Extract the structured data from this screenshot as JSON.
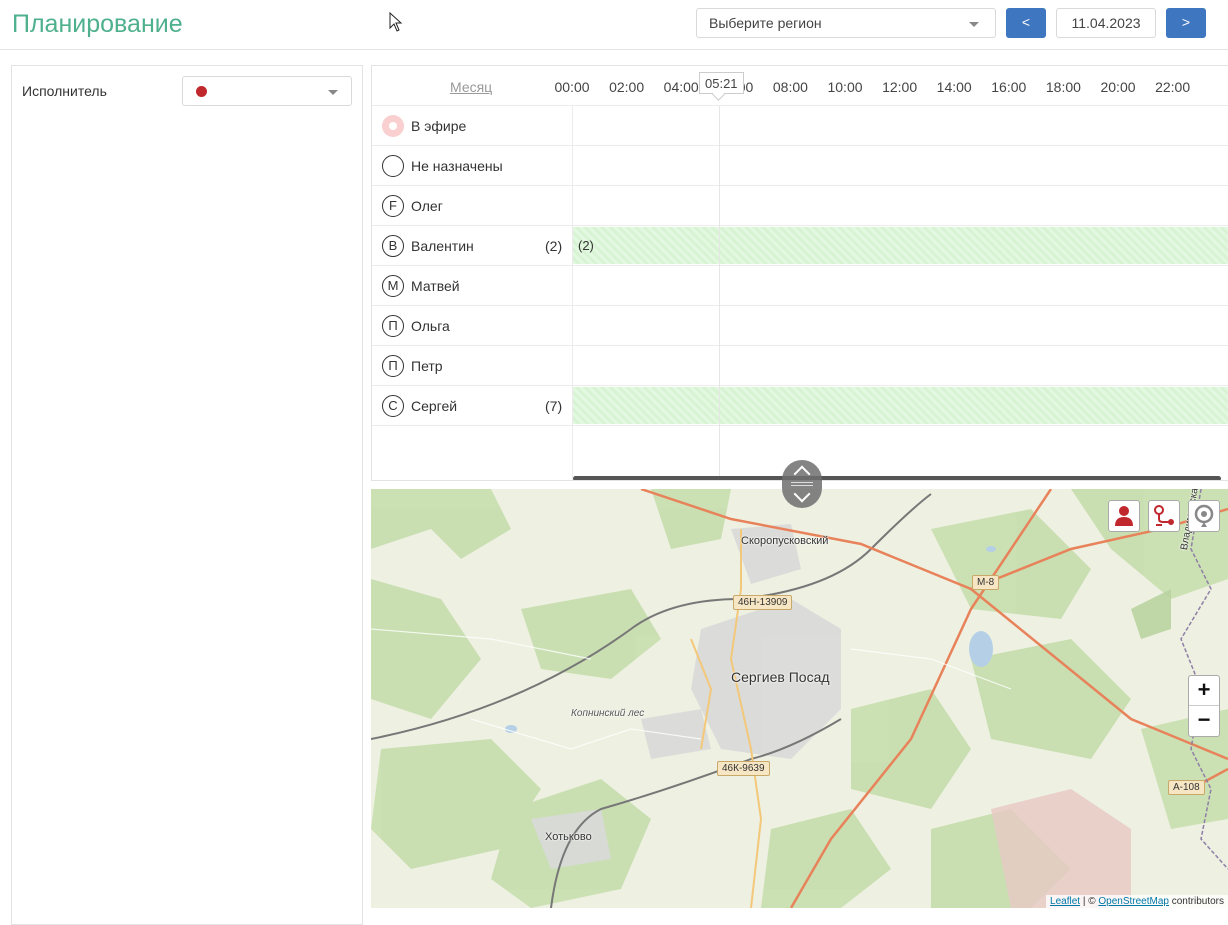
{
  "header": {
    "title": "Планирование",
    "region_placeholder": "Выберите регион",
    "prev_label": "<",
    "next_label": ">",
    "date": "11.04.2023"
  },
  "filters": {
    "executor_label": "Исполнитель",
    "executor_dot_color": "#c0282d"
  },
  "schedule": {
    "month_link": "Месяц",
    "now_time": "05:21",
    "hours": [
      "00:00",
      "02:00",
      "04:00",
      "06:00",
      "08:00",
      "10:00",
      "12:00",
      "14:00",
      "16:00",
      "18:00",
      "20:00",
      "22:00"
    ],
    "rows": [
      {
        "avatar": "",
        "kind": "live",
        "name": "В эфире",
        "count": "",
        "bar_label": "",
        "has_bar": false
      },
      {
        "avatar": "",
        "kind": "circle",
        "name": "Не назначены",
        "count": "",
        "bar_label": "",
        "has_bar": false
      },
      {
        "avatar": "F",
        "kind": "circle",
        "name": "Олег",
        "count": "",
        "bar_label": "",
        "has_bar": false
      },
      {
        "avatar": "В",
        "kind": "circle",
        "name": "Валентин",
        "count": "(2)",
        "bar_label": "(2)",
        "has_bar": true
      },
      {
        "avatar": "М",
        "kind": "circle",
        "name": "Матвей",
        "count": "",
        "bar_label": "",
        "has_bar": false
      },
      {
        "avatar": "П",
        "kind": "circle",
        "name": "Ольга",
        "count": "",
        "bar_label": "",
        "has_bar": false
      },
      {
        "avatar": "П",
        "kind": "circle",
        "name": "Петр",
        "count": "",
        "bar_label": "",
        "has_bar": false
      },
      {
        "avatar": "С",
        "kind": "circle",
        "name": "Сергей",
        "count": "(7)",
        "bar_label": "",
        "has_bar": true
      }
    ]
  },
  "map": {
    "labels": {
      "skoropuskovsky": "Скоропусковский",
      "sergiev_posad": "Сергиев Посад",
      "khotkovo": "Хотьково",
      "kopninsky_les": "Копнинский лес",
      "vladimirskaya": "Владимирская"
    },
    "roads": {
      "r1": "46Н-13909",
      "r2": "46К-9639",
      "m8": "М-8",
      "a108": "А-108"
    },
    "controls": {
      "person_icon": "person-icon",
      "route_icon": "route-icon",
      "geo_icon": "geo-target-icon",
      "zoom_in": "+",
      "zoom_out": "−"
    },
    "attribution": {
      "leaflet": "Leaflet",
      "sep": " | © ",
      "osm": "OpenStreetMap",
      "contributors": " contributors"
    },
    "colors": {
      "accent": "#c0282d",
      "forest": "#c8dfb0",
      "urban": "#d9d9d9",
      "road": "#e8825a"
    }
  }
}
